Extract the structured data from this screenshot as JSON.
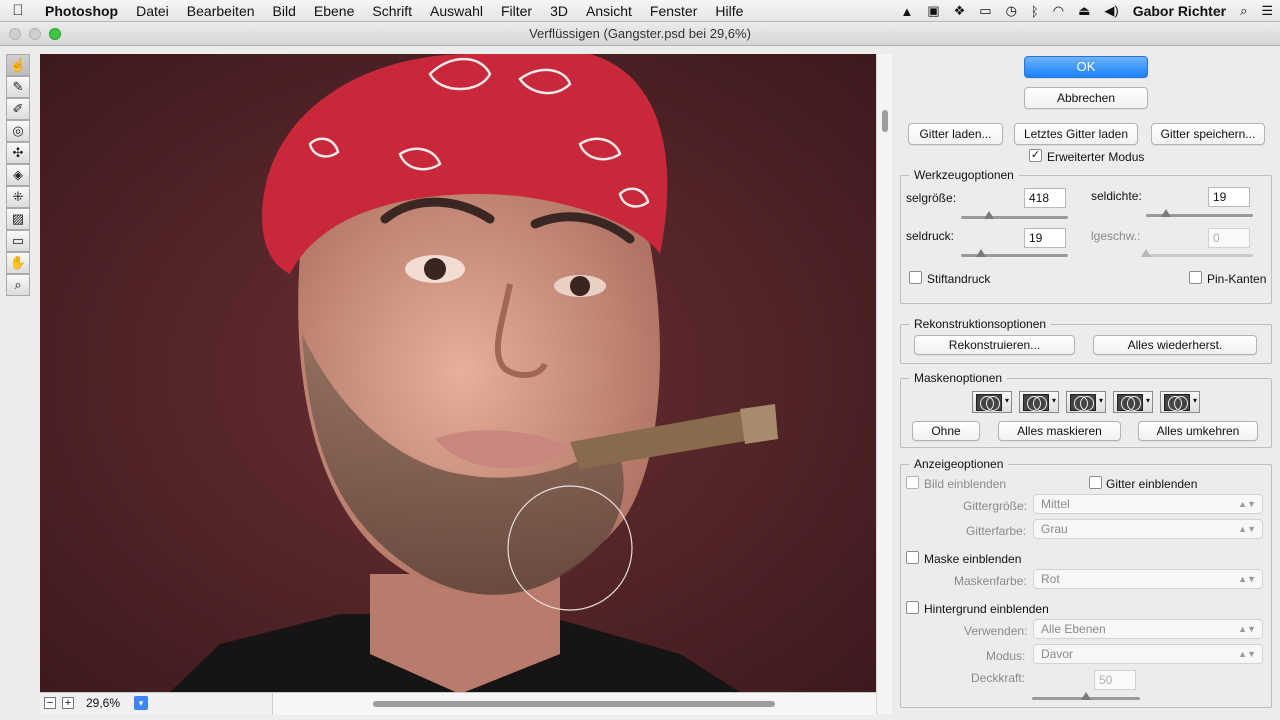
{
  "menubar": {
    "apple": "",
    "items": [
      "Photoshop",
      "Datei",
      "Bearbeiten",
      "Bild",
      "Ebene",
      "Schrift",
      "Auswahl",
      "Filter",
      "3D",
      "Ansicht",
      "Fenster",
      "Hilfe"
    ],
    "user": "Gabor Richter"
  },
  "window": {
    "title": "Verflüssigen (Gangster.psd bei 29,6%)"
  },
  "status": {
    "zoom": "29,6%"
  },
  "panel": {
    "ok": "OK",
    "cancel": "Abbrechen",
    "load_mesh": "Gitter laden...",
    "load_last_mesh": "Letztes Gitter laden",
    "save_mesh": "Gitter speichern...",
    "advanced_mode": "Erweiterter Modus",
    "advanced_mode_checked": true,
    "tool_options": {
      "title": "Werkzeugoptionen",
      "brush_size_label": "selgröße:",
      "brush_size": "418",
      "brush_size_level": 0.26,
      "brush_density_label": "seldichte:",
      "brush_density": "19",
      "brush_density_level": 0.19,
      "brush_pressure_label": "seldruck:",
      "brush_pressure": "19",
      "brush_pressure_level": 0.19,
      "brush_rate_label": "lgeschw.:",
      "brush_rate": "0",
      "brush_rate_level": 0.0,
      "stylus_pressure": "Stiftandruck",
      "pin_edges": "Pin-Kanten"
    },
    "reconstruct_options": {
      "title": "Rekonstruktionsoptionen",
      "reconstruct": "Rekonstruieren...",
      "restore_all": "Alles wiederherst."
    },
    "mask_options": {
      "title": "Maskenoptionen",
      "none": "Ohne",
      "mask_all": "Alles maskieren",
      "invert_all": "Alles umkehren"
    },
    "view_options": {
      "title": "Anzeigeoptionen",
      "show_image": "Bild einblenden",
      "show_mesh": "Gitter einblenden",
      "mesh_size_label": "Gittergröße:",
      "mesh_size": "Mittel",
      "mesh_color_label": "Gitterfarbe:",
      "mesh_color": "Grau",
      "show_mask": "Maske einblenden",
      "mask_color_label": "Maskenfarbe:",
      "mask_color": "Rot",
      "show_backdrop": "Hintergrund einblenden",
      "use_label": "Verwenden:",
      "use": "Alle Ebenen",
      "mode_label": "Modus:",
      "mode": "Davor",
      "opacity_label": "Deckkraft:",
      "opacity": "50",
      "opacity_level": 0.5
    }
  },
  "colors": {
    "accent": "#1a82fb",
    "bandana": "#c8283a",
    "background": "#4a2023"
  }
}
